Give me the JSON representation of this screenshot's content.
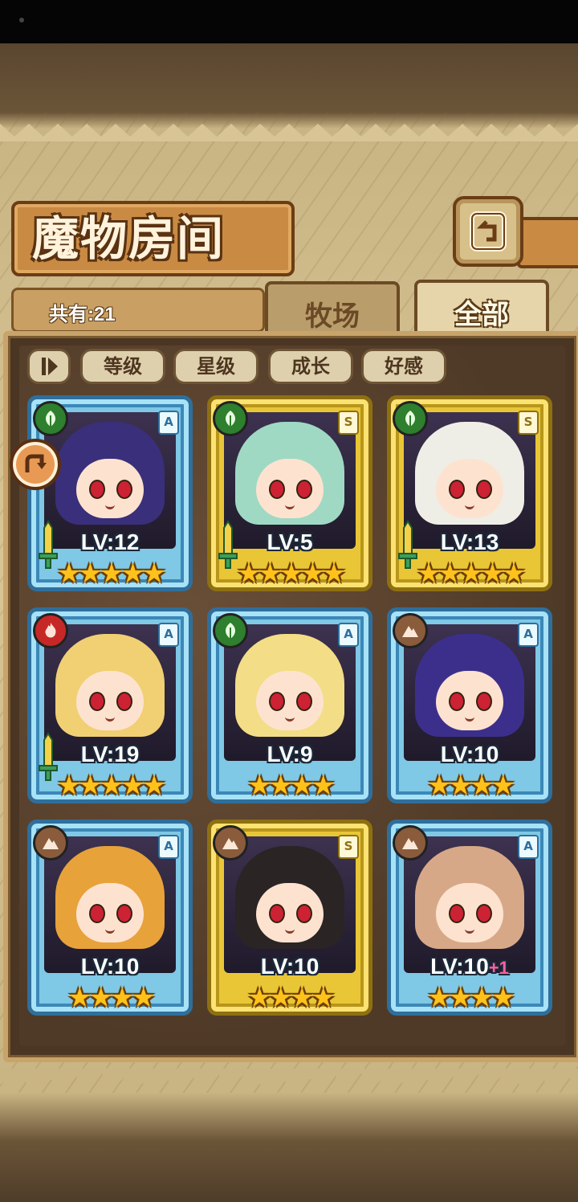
{
  "header": {
    "title": "魔物房间"
  },
  "count": {
    "label": "共有:21"
  },
  "tabs": [
    {
      "label": "牧场",
      "active": false
    },
    {
      "label": "全部",
      "active": true
    }
  ],
  "sort_buttons": [
    "等级",
    "星级",
    "成长",
    "好感"
  ],
  "monsters": [
    {
      "level": "LV:12",
      "plus": "",
      "rank": "A",
      "element": "grass-icon",
      "frame": "blue",
      "stars": "★★★★★",
      "hair": "#3a2f7a"
    },
    {
      "level": "LV:5",
      "plus": "",
      "rank": "S",
      "element": "grass-icon",
      "frame": "gold",
      "stars": "★★★★★",
      "hair": "#9fd9c4"
    },
    {
      "level": "LV:13",
      "plus": "",
      "rank": "S",
      "element": "grass-icon",
      "frame": "gold",
      "stars": "★★★★★",
      "hair": "#eeeee6"
    },
    {
      "level": "LV:19",
      "plus": "",
      "rank": "A",
      "element": "fire-icon",
      "frame": "blue",
      "stars": "★★★★★",
      "hair": "#f1cf73"
    },
    {
      "level": "LV:9",
      "plus": "",
      "rank": "A",
      "element": "grass-icon",
      "frame": "blue",
      "stars": "★★★★",
      "hair": "#f3dd86"
    },
    {
      "level": "LV:10",
      "plus": "",
      "rank": "A",
      "element": "earth-icon",
      "frame": "blue",
      "stars": "★★★★",
      "hair": "#3c2f8c"
    },
    {
      "level": "LV:10",
      "plus": "",
      "rank": "A",
      "element": "earth-icon",
      "frame": "blue",
      "stars": "★★★★",
      "hair": "#e8a23a"
    },
    {
      "level": "LV:10",
      "plus": "",
      "rank": "S",
      "element": "earth-icon",
      "frame": "gold",
      "stars": "★★★★",
      "hair": "#2a2424"
    },
    {
      "level": "LV:10",
      "plus": "+1",
      "rank": "A",
      "element": "earth-icon",
      "frame": "blue",
      "stars": "★★★★",
      "hair": "#d7a888"
    }
  ],
  "colors": {
    "frame_blue": "#7fc8e6",
    "frame_gold": "#e9c636",
    "star": "#ffc21a",
    "plus": "#ff5fa0"
  }
}
